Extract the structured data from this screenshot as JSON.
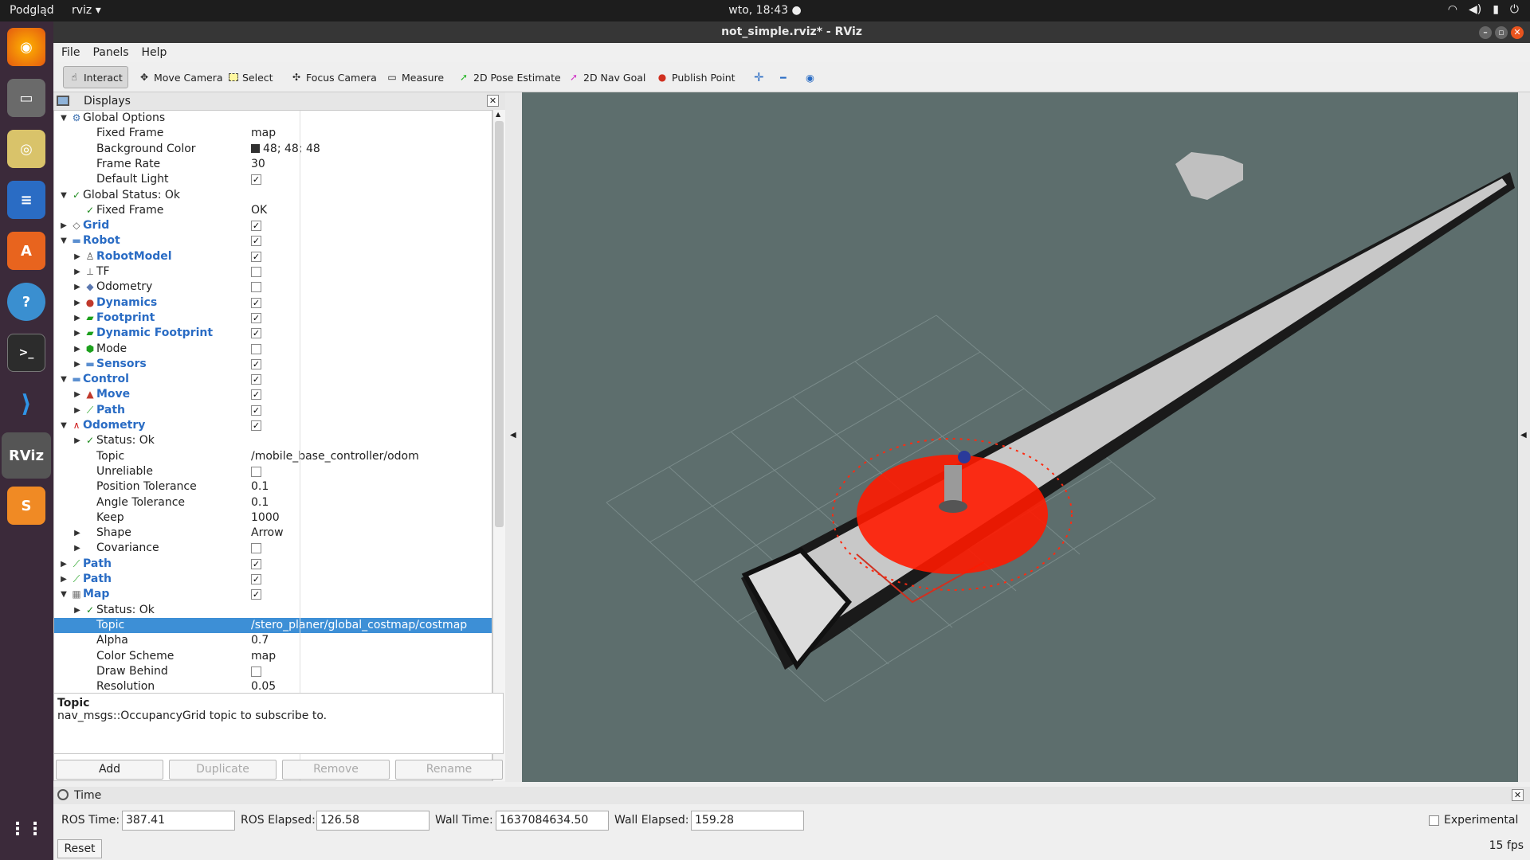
{
  "topbar": {
    "activities": "Podgląd",
    "app_menu": "rviz ▾",
    "clock": "wto, 18:43 ●",
    "tray": [
      "wifi-icon",
      "volume-icon",
      "battery-icon",
      "power-icon"
    ]
  },
  "dock": {
    "items": [
      "firefox-icon",
      "files-icon",
      "rhythmbox-icon",
      "writer-icon",
      "software-icon",
      "help-icon",
      "terminal-icon",
      "vscode-icon",
      "rviz-icon",
      "sublime-icon"
    ],
    "rviz_label": "RViz",
    "tooltip": "rviz"
  },
  "window": {
    "title": "not_simple.rviz* - RViz"
  },
  "menu": [
    "File",
    "Panels",
    "Help"
  ],
  "toolbar": {
    "interact": "Interact",
    "move_camera": "Move Camera",
    "select": "Select",
    "focus_camera": "Focus Camera",
    "measure": "Measure",
    "pose_estimate": "2D Pose Estimate",
    "nav_goal": "2D Nav Goal",
    "publish_point": "Publish Point"
  },
  "displays": {
    "title": "Displays",
    "rows": [
      {
        "label": "Global Options",
        "indent": 0,
        "arrow": "▼",
        "icon": "gear-icon"
      },
      {
        "label": "Fixed Frame",
        "indent": 1,
        "value": "map"
      },
      {
        "label": "Background Color",
        "indent": 1,
        "value": "48; 48; 48",
        "swatch": "#303030"
      },
      {
        "label": "Frame Rate",
        "indent": 1,
        "value": "30"
      },
      {
        "label": "Default Light",
        "indent": 1,
        "check": true
      },
      {
        "label": "Global Status: Ok",
        "indent": 0,
        "arrow": "▼",
        "icon": "check-icon"
      },
      {
        "label": "Fixed Frame",
        "indent": 1,
        "value": "OK",
        "icon": "check-icon"
      },
      {
        "label": "Grid",
        "indent": 0,
        "arrow": "▶",
        "icon": "grid-icon",
        "check": true,
        "blue": true
      },
      {
        "label": "Robot",
        "indent": 0,
        "arrow": "▼",
        "icon": "folder-icon",
        "check": true,
        "blue": true
      },
      {
        "label": "RobotModel",
        "indent": 1,
        "arrow": "▶",
        "icon": "robot-model-icon",
        "check": true,
        "blue": true
      },
      {
        "label": "TF",
        "indent": 1,
        "arrow": "▶",
        "icon": "tf-icon",
        "check": false
      },
      {
        "label": "Odometry",
        "indent": 1,
        "arrow": "▶",
        "icon": "odometry-icon",
        "check": false
      },
      {
        "label": "Dynamics",
        "indent": 1,
        "arrow": "▶",
        "icon": "dynamics-icon",
        "check": true,
        "blue": true
      },
      {
        "label": "Footprint",
        "indent": 1,
        "arrow": "▶",
        "icon": "polygon-icon",
        "check": true,
        "blue": true
      },
      {
        "label": "Dynamic Footprint",
        "indent": 1,
        "arrow": "▶",
        "icon": "polygon-icon",
        "check": true,
        "blue": true
      },
      {
        "label": "Mode",
        "indent": 1,
        "arrow": "▶",
        "icon": "marker-icon",
        "check": false
      },
      {
        "label": "Sensors",
        "indent": 1,
        "arrow": "▶",
        "icon": "folder-icon",
        "check": true,
        "blue": true
      },
      {
        "label": "Control",
        "indent": 0,
        "arrow": "▼",
        "icon": "folder-icon",
        "check": true,
        "blue": true
      },
      {
        "label": "Move",
        "indent": 1,
        "arrow": "▶",
        "icon": "move-icon",
        "check": true,
        "blue": true
      },
      {
        "label": "Path",
        "indent": 1,
        "arrow": "▶",
        "icon": "path-icon",
        "check": true,
        "blue": true
      },
      {
        "label": "Odometry",
        "indent": 0,
        "arrow": "▼",
        "icon": "odometry-red-icon",
        "check": true,
        "blue": true
      },
      {
        "label": "Status: Ok",
        "indent": 1,
        "arrow": "▶",
        "icon": "check-icon"
      },
      {
        "label": "Topic",
        "indent": 1,
        "value": "/mobile_base_controller/odom"
      },
      {
        "label": "Unreliable",
        "indent": 1,
        "check": false
      },
      {
        "label": "Position Tolerance",
        "indent": 1,
        "value": "0.1"
      },
      {
        "label": "Angle Tolerance",
        "indent": 1,
        "value": "0.1"
      },
      {
        "label": "Keep",
        "indent": 1,
        "value": "1000"
      },
      {
        "label": "Shape",
        "indent": 1,
        "arrow": "▶",
        "value": "Arrow"
      },
      {
        "label": "Covariance",
        "indent": 1,
        "arrow": "▶",
        "check": false
      },
      {
        "label": "Path",
        "indent": 0,
        "arrow": "▶",
        "icon": "path-icon",
        "check": true,
        "blue": true
      },
      {
        "label": "Path",
        "indent": 0,
        "arrow": "▶",
        "icon": "path-icon",
        "check": true,
        "blue": true
      },
      {
        "label": "Map",
        "indent": 0,
        "arrow": "▼",
        "icon": "map-icon",
        "check": true,
        "blue": true
      },
      {
        "label": "Status: Ok",
        "indent": 1,
        "arrow": "▶",
        "icon": "check-icon"
      },
      {
        "label": "Topic",
        "indent": 1,
        "value": "/stero_planer/global_costmap/costmap",
        "selected": true
      },
      {
        "label": "Alpha",
        "indent": 1,
        "value": "0.7"
      },
      {
        "label": "Color Scheme",
        "indent": 1,
        "value": "map"
      },
      {
        "label": "Draw Behind",
        "indent": 1,
        "check": false
      },
      {
        "label": "Resolution",
        "indent": 1,
        "value": "0.05"
      }
    ]
  },
  "help": {
    "title": "Topic",
    "text": "nav_msgs::OccupancyGrid topic to subscribe to."
  },
  "buttons": {
    "add": "Add",
    "duplicate": "Duplicate",
    "remove": "Remove",
    "rename": "Rename"
  },
  "time": {
    "title": "Time",
    "ros_time_label": "ROS Time:",
    "ros_time": "387.41",
    "ros_elapsed_label": "ROS Elapsed:",
    "ros_elapsed": "126.58",
    "wall_time_label": "Wall Time:",
    "wall_time": "1637084634.50",
    "wall_elapsed_label": "Wall Elapsed:",
    "wall_elapsed": "159.28",
    "experimental": "Experimental",
    "reset": "Reset",
    "fps": "15 fps"
  },
  "colors": {
    "viewport_bg": "#5d6e6d",
    "selection": "#3d8fd6",
    "display_link": "#2a6cc4"
  }
}
